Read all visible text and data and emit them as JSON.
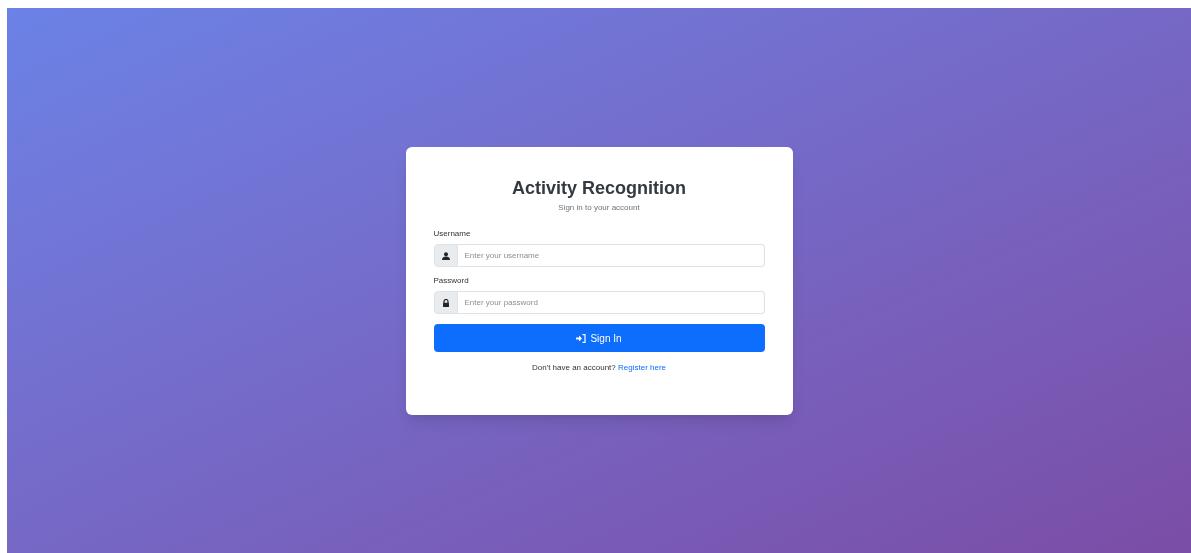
{
  "card": {
    "title": "Activity Recognition",
    "subtitle": "Sign in to your account"
  },
  "fields": [
    {
      "kind": "user",
      "label": "Username",
      "placeholder": "Enter your username"
    },
    {
      "kind": "lock",
      "label": "Password",
      "placeholder": "Enter your password"
    }
  ],
  "submit": {
    "label": "Sign In"
  },
  "footer": {
    "text": "Don't have an account?",
    "link": "Register here"
  }
}
